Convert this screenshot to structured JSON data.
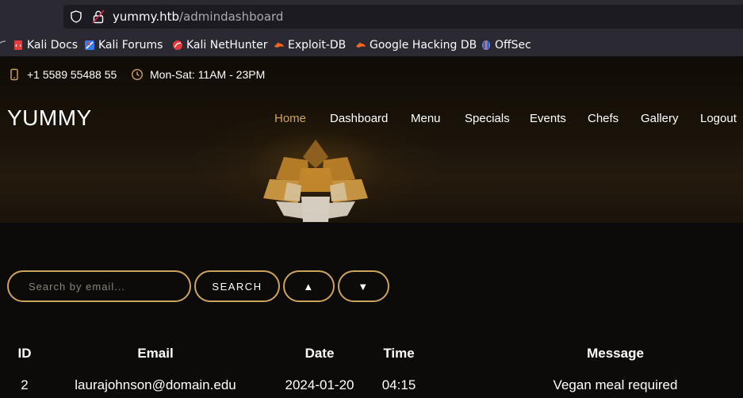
{
  "browser": {
    "url_host": "yummy.htb",
    "url_path": "/admindashboard",
    "bookmarks": [
      {
        "label": "Kali Docs",
        "icon": "kali-docs-icon",
        "color": "#e23b3b"
      },
      {
        "label": "Kali Forums",
        "icon": "kali-forums-icon",
        "color": "#367bf0"
      },
      {
        "label": "Kali NetHunter",
        "icon": "kali-nethunter-icon",
        "color": "#e23b3b"
      },
      {
        "label": "Exploit-DB",
        "icon": "exploit-db-icon",
        "color": "#f26522"
      },
      {
        "label": "Google Hacking DB",
        "icon": "ghdb-icon",
        "color": "#f26522"
      },
      {
        "label": "OffSec",
        "icon": "offsec-icon",
        "color": "#5b8def"
      }
    ]
  },
  "topbar": {
    "phone": "+1 5589 55488 55",
    "hours": "Mon-Sat: 11AM - 23PM"
  },
  "header": {
    "brand": "YUMMY",
    "nav": [
      "Home",
      "Dashboard",
      "Menu",
      "Specials",
      "Events",
      "Chefs",
      "Gallery",
      "Logout"
    ],
    "active_index": 0
  },
  "controls": {
    "search_placeholder": "Search by email...",
    "search_button": "SEARCH",
    "sort_asc": "▲",
    "sort_desc": "▼"
  },
  "table": {
    "headers": [
      "ID",
      "Email",
      "Date",
      "Time",
      "Message"
    ],
    "rows": [
      [
        "2",
        "laurajohnson@domain.edu",
        "2024-01-20",
        "04:15",
        "Vegan meal required"
      ]
    ]
  },
  "theme": {
    "accent": "#cda45e",
    "background": "#0c0b09"
  }
}
